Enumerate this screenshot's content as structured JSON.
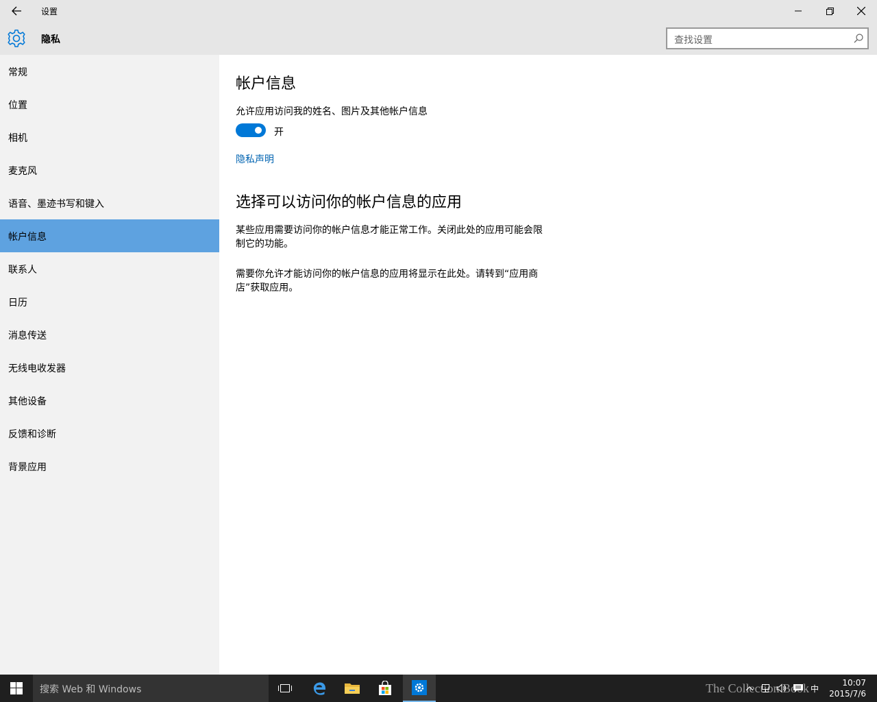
{
  "window": {
    "title": "设置"
  },
  "header": {
    "title": "隐私",
    "search_placeholder": "查找设置"
  },
  "sidebar": {
    "items": [
      {
        "label": "常规"
      },
      {
        "label": "位置"
      },
      {
        "label": "相机"
      },
      {
        "label": "麦克风"
      },
      {
        "label": "语音、墨迹书写和键入"
      },
      {
        "label": "帐户信息",
        "selected": true
      },
      {
        "label": "联系人"
      },
      {
        "label": "日历"
      },
      {
        "label": "消息传送"
      },
      {
        "label": "无线电收发器"
      },
      {
        "label": "其他设备"
      },
      {
        "label": "反馈和诊断"
      },
      {
        "label": "背景应用"
      }
    ]
  },
  "main": {
    "heading": "帐户信息",
    "permission_label": "允许应用访问我的姓名、图片及其他帐户信息",
    "toggle": {
      "state": "on",
      "label": "开"
    },
    "privacy_link": "隐私声明",
    "apps_heading": "选择可以访问你的帐户信息的应用",
    "para1": "某些应用需要访问你的帐户信息才能正常工作。关闭此处的应用可能会限制它的功能。",
    "para2": "需要你允许才能访问你的帐户信息的应用将显示在此处。请转到“应用商店”获取应用。"
  },
  "taskbar": {
    "search_placeholder": "搜索 Web 和 Windows",
    "apps": [
      "task-view",
      "edge",
      "file-explorer",
      "store",
      "settings"
    ],
    "active_app": "settings",
    "ime": "中",
    "time": "10:07",
    "date": "2015/7/6",
    "watermark": "The Collection Book"
  },
  "colors": {
    "accent": "#0078d7",
    "sidebar_selected": "#5ea2e0",
    "link": "#0063b1",
    "chrome_bg": "#e6e6e6",
    "sidebar_bg": "#f2f2f2",
    "taskbar_bg": "#1f1f1f"
  }
}
